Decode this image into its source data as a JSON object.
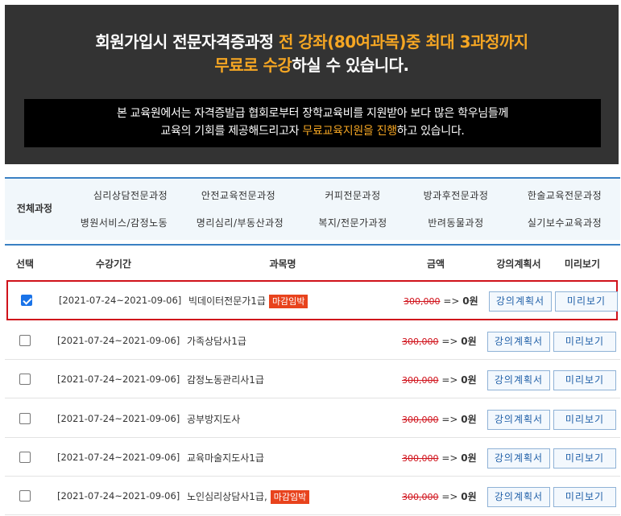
{
  "banner": {
    "line1_a": "회원가입시 전문자격증과정 ",
    "line1_b": "전 강좌(80여과목)중 최대 3과정까지",
    "line2_a": "무료로 수강",
    "line2_b": "하실 수 있습니다.",
    "notice_line1": "본 교육원에서는 자격증발급 협회로부터 장학교육비를 지원받아 보다 많은 학우님들께",
    "notice_line2_a": "교육의 기회를 제공해드리고자 ",
    "notice_line2_b": "무료교육지원을 진행",
    "notice_line2_c": "하고 있습니다."
  },
  "categories": {
    "all": "전체과정",
    "row1": [
      "심리상담전문과정",
      "안전교육전문과정",
      "커피전문과정",
      "방과후전문과정",
      "한술교육전문과정"
    ],
    "row2": [
      "병원서비스/감정노동",
      "명리심리/부동산과정",
      "복지/전문가과정",
      "반려동물과정",
      "실기보수교육과정"
    ]
  },
  "table": {
    "headers": {
      "select": "선택",
      "period": "수강기간",
      "course": "과목명",
      "price": "금액",
      "plan": "강의계획서",
      "preview": "미리보기"
    },
    "rows": [
      {
        "checked": true,
        "period": "[2021-07-24~2021-09-06]",
        "course": "빅데이터전문가1급",
        "badge": "마감임박",
        "old_price": "300,000",
        "arrow": "=>",
        "new_price": "0원",
        "plan": "강의계획서",
        "preview": "미리보기"
      },
      {
        "checked": false,
        "period": "[2021-07-24~2021-09-06]",
        "course": "가족상담사1급",
        "badge": "",
        "old_price": "300,000",
        "arrow": "=>",
        "new_price": "0원",
        "plan": "강의계획서",
        "preview": "미리보기"
      },
      {
        "checked": false,
        "period": "[2021-07-24~2021-09-06]",
        "course": "감정노동관리사1급",
        "badge": "",
        "old_price": "300,000",
        "arrow": "=>",
        "new_price": "0원",
        "plan": "강의계획서",
        "preview": "미리보기"
      },
      {
        "checked": false,
        "period": "[2021-07-24~2021-09-06]",
        "course": "공부방지도사",
        "badge": "",
        "old_price": "300,000",
        "arrow": "=>",
        "new_price": "0원",
        "plan": "강의계획서",
        "preview": "미리보기"
      },
      {
        "checked": false,
        "period": "[2021-07-24~2021-09-06]",
        "course": "교육마술지도사1급",
        "badge": "",
        "old_price": "300,000",
        "arrow": "=>",
        "new_price": "0원",
        "plan": "강의계획서",
        "preview": "미리보기"
      },
      {
        "checked": false,
        "period": "[2021-07-24~2021-09-06]",
        "course": "노인심리상담사1급,",
        "badge": "마감임박",
        "old_price": "300,000",
        "arrow": "=>",
        "new_price": "0원",
        "plan": "강의계획서",
        "preview": "미리보기"
      }
    ]
  },
  "colors": {
    "highlight": "#f5a623",
    "accent_blue": "#3a80c3",
    "selected_border": "#d0121b",
    "badge": "#e8431d"
  }
}
